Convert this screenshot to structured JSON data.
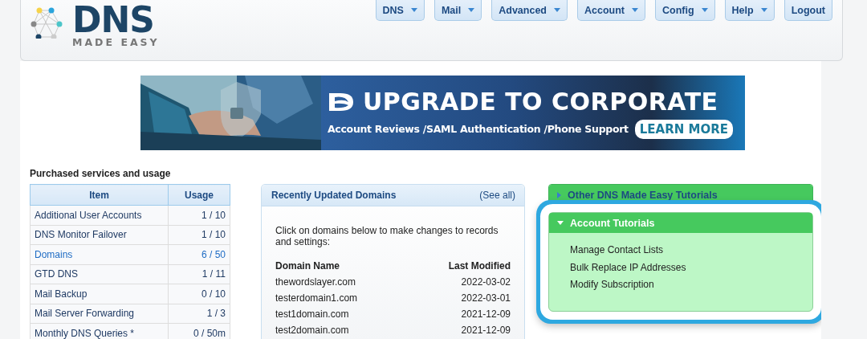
{
  "header": {
    "logo": {
      "title": "DNS",
      "subtitle": "MADE EASY"
    },
    "nav": [
      {
        "label": "DNS",
        "dropdown": true
      },
      {
        "label": "Mail",
        "dropdown": true
      },
      {
        "label": "Advanced",
        "dropdown": true
      },
      {
        "label": "Account",
        "dropdown": true
      },
      {
        "label": "Config",
        "dropdown": true
      },
      {
        "label": "Help",
        "dropdown": true
      },
      {
        "label": "Logout",
        "dropdown": false
      }
    ]
  },
  "banner": {
    "headline": "UPGRADE TO CORPORATE",
    "tagline": "Account Reviews /SAML Authentication /Phone Support",
    "button": "LEARN MORE"
  },
  "usage": {
    "title": "Purchased services and usage",
    "columns": [
      "Item",
      "Usage"
    ],
    "rows": [
      {
        "item": "Additional User Accounts",
        "usage": "1 / 10",
        "link": false
      },
      {
        "item": "DNS Monitor Failover",
        "usage": "1 / 10",
        "link": false
      },
      {
        "item": "Domains",
        "usage": "6 / 50",
        "link": true
      },
      {
        "item": "GTD DNS",
        "usage": "1 / 11",
        "link": false
      },
      {
        "item": "Mail Backup",
        "usage": "0 / 10",
        "link": false
      },
      {
        "item": "Mail Server Forwarding",
        "usage": "1 / 3",
        "link": false
      },
      {
        "item": "Monthly DNS Queries *",
        "usage": "0 / 50m",
        "link": false
      }
    ]
  },
  "recent_domains": {
    "title": "Recently Updated Domains",
    "see_all": "(See all)",
    "intro": "Click on domains below to make changes to records and settings:",
    "columns": [
      "Domain Name",
      "Last Modified"
    ],
    "rows": [
      {
        "domain": "thewordslayer.com",
        "modified": "2022-03-02"
      },
      {
        "domain": "testerdomain1.com",
        "modified": "2022-03-01"
      },
      {
        "domain": "test1domain.com",
        "modified": "2021-12-09"
      },
      {
        "domain": "test2domain.com",
        "modified": "2021-12-09"
      }
    ]
  },
  "tutorials": [
    {
      "title": "Other DNS Made Easy Tutorials",
      "expanded": false,
      "highlighted": false
    },
    {
      "title": "Account Tutorials",
      "expanded": true,
      "highlighted": true,
      "items": [
        "Manage Contact Lists",
        "Bulk Replace IP Addresses",
        "Modify Subscription"
      ]
    }
  ]
}
